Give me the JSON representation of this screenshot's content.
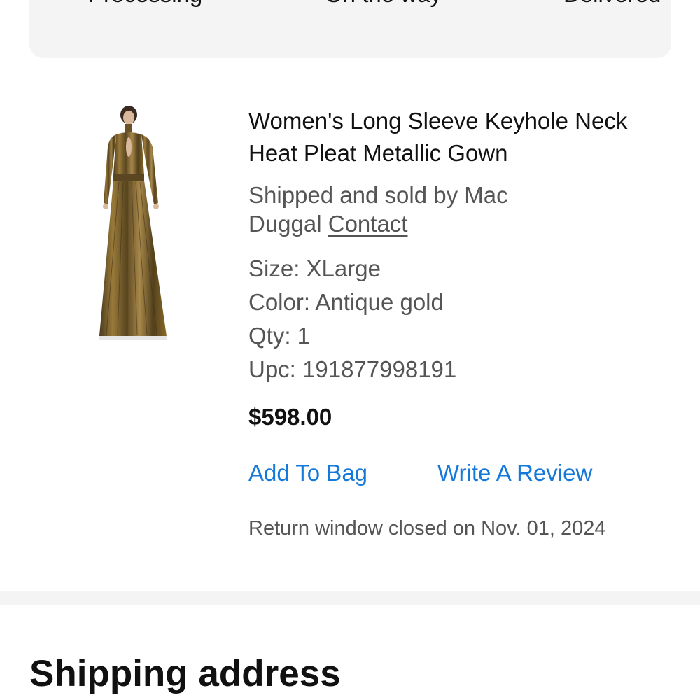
{
  "status_tracker": {
    "steps": [
      "Processing",
      "On the way",
      "Delivered"
    ]
  },
  "product": {
    "title": "Women's Long Sleeve Keyhole Neck Heat Pleat Metallic Gown",
    "seller_text": "Shipped and sold by Mac Duggal",
    "contact_label": "Contact",
    "size": "Size: XLarge",
    "color": "Color: Antique gold",
    "qty": "Qty: 1",
    "upc": "Upc: 191877998191",
    "price": "$598.00",
    "image_alt": "Antique gold metallic pleated long sleeve gown"
  },
  "actions": {
    "add_to_bag": "Add To Bag",
    "write_review": "Write A Review"
  },
  "return_note": "Return window closed on Nov. 01, 2024",
  "shipping": {
    "title": "Shipping address"
  },
  "colors": {
    "link": "#1479d8",
    "card_bg": "#f4f4f4",
    "muted_text": "#555555",
    "gown_gold": "#8a6a2a"
  }
}
